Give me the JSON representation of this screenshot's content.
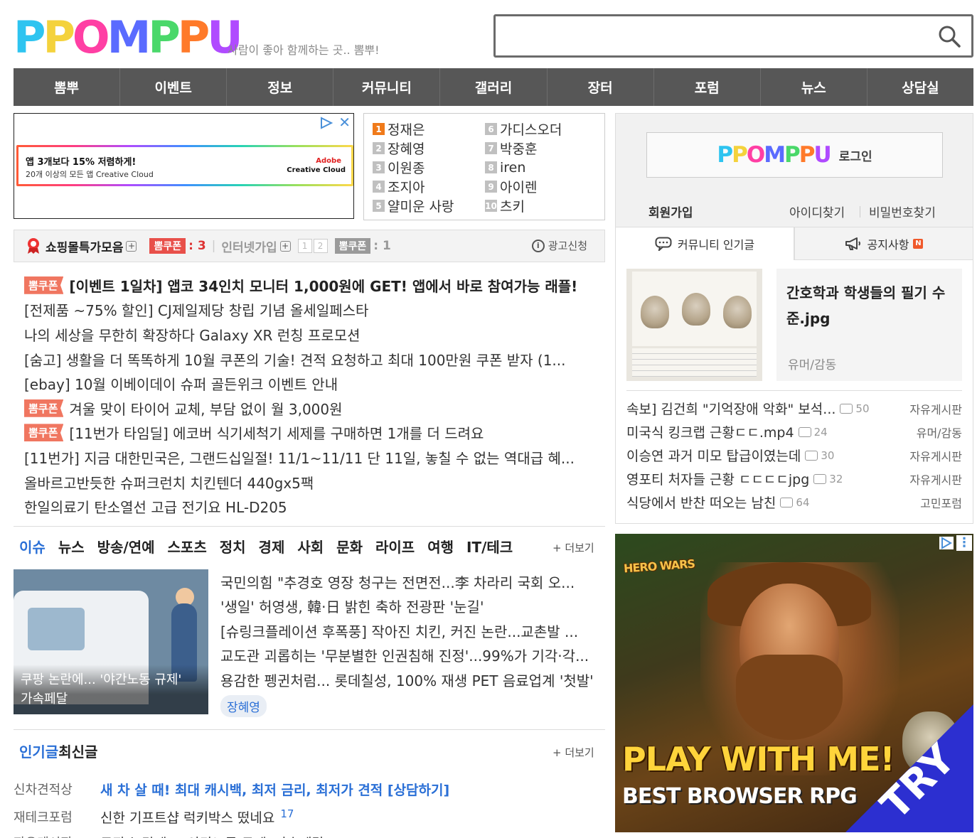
{
  "header": {
    "logo_letters": [
      "P",
      "P",
      "O",
      "M",
      "P",
      "P",
      "U"
    ],
    "logo_colors": [
      "#2ec4f0",
      "#f4d23c",
      "#ff3fa4",
      "#5a6bff",
      "#4ad86a",
      "#ff7a2a",
      "#b04bff"
    ],
    "tagline": "사람이 좋아 함께하는 곳.. 뽐뿌!",
    "search_placeholder": ""
  },
  "nav": [
    "뽐뿌",
    "이벤트",
    "정보",
    "커뮤니티",
    "갤러리",
    "장터",
    "포럼",
    "뉴스",
    "상담실"
  ],
  "ad_small": {
    "title": "앱 3개보다 15% 저렴하게!",
    "subtitle": "20개 이상의 모든 앱 Creative Cloud",
    "brand_top": "Adobe",
    "brand_bottom": "Creative Cloud",
    "close": "✕"
  },
  "ranking": {
    "left": [
      {
        "num": "1",
        "name": "정재은"
      },
      {
        "num": "2",
        "name": "장혜영"
      },
      {
        "num": "3",
        "name": "이원종"
      },
      {
        "num": "4",
        "name": "조지아"
      },
      {
        "num": "5",
        "name": "얄미운 사랑"
      }
    ],
    "right": [
      {
        "num": "6",
        "name": "가디스오더"
      },
      {
        "num": "7",
        "name": "박중훈"
      },
      {
        "num": "8",
        "name": "iren"
      },
      {
        "num": "9",
        "name": "아이렌"
      },
      {
        "num": "10",
        "name": "츠키"
      }
    ]
  },
  "shopbar": {
    "title": "쇼핑몰특가모음",
    "plus": "+",
    "coupon_label": "뽐쿠폰",
    "coupon_count": ": 3",
    "sep": "|",
    "internet": "인터넷가입",
    "pages": [
      "1",
      "2"
    ],
    "coupon_count2": ": 1",
    "ad_request": "광고신청",
    "info": "i"
  },
  "hotlist": [
    {
      "badge": "뽐쿠폰",
      "text": "[이벤트 1일차] 앱코 34인치 모니터 1,000원에 GET! 앱에서 바로 참여가능 래플!",
      "strong": true
    },
    {
      "badge": "",
      "text": "[전제품 ~75% 할인] CJ제일제당 창립 기념 올세일페스타",
      "strong": false
    },
    {
      "badge": "",
      "text": "나의 세상을 무한히 확장하다 Galaxy XR 런칭 프로모션",
      "strong": false
    },
    {
      "badge": "",
      "text": "[숨고] 생활을 더 똑똑하게 10월 쿠폰의 기술! 견적 요청하고 최대 100만원 쿠폰 받자 (1...",
      "strong": false
    },
    {
      "badge": "",
      "text": "[ebay] 10월 이베이데이 슈퍼 골든위크 이벤트 안내",
      "strong": false
    },
    {
      "badge": "뽐쿠폰",
      "text": "겨울 맞이 타이어 교체, 부담 없이 월 3,000원",
      "strong": false
    },
    {
      "badge": "뽐쿠폰",
      "text": "[11번가 타임딜] 에코버 식기세척기 세제를 구매하면 1개를 더 드려요",
      "strong": false
    },
    {
      "badge": "",
      "text": "[11번가] 지금 대한민국은, 그랜드십일절! 11/1~11/11 단 11일, 놓칠 수 없는 역대급 혜...",
      "strong": false
    },
    {
      "badge": "",
      "text": "올바르고반듯한 슈퍼크런치 치킨텐더 440gx5팩",
      "strong": false
    },
    {
      "badge": "",
      "text": "한일의료기 탄소열선 고급 전기요 HL-D205",
      "strong": false
    }
  ],
  "news": {
    "tabs": [
      "이슈",
      "뉴스",
      "방송/연예",
      "스포츠",
      "정치",
      "경제",
      "사회",
      "문화",
      "라이프",
      "여행",
      "IT/테크"
    ],
    "more": "+ 더보기",
    "image_caption_1": "쿠팡 논란에... '야간노동 규제'",
    "image_caption_2": "가속페달",
    "items": [
      "국민의힘 \"추경호 영장 청구는 전면전...李 차라리 국회 오...",
      "'생일' 허영생, 韓·日 밝힌 축하 전광판 '눈길'",
      "[슈링크플레이션 후폭풍] 작아진 치킨, 커진 논란...교촌발 ...",
      "교도관 괴롭히는 '무분별한 인권침해 진정'...99%가 기각·각...",
      "용감한 펭귄처럼... 롯데칠성, 100% 재생 PET 음료업계 '첫발'"
    ],
    "tag": "장혜영"
  },
  "popular": {
    "tabs": [
      "인기글",
      "최신글"
    ],
    "more": "+ 더보기",
    "rows": [
      {
        "cat": "신차견적상",
        "title": "새 차 살 때! 최대 캐시백, 최저 금리, 최저가 견적 [상담하기]",
        "num": "",
        "blue": true
      },
      {
        "cat": "재테크포럼",
        "title": "신한 기프트샵 럭키박스 떴네요",
        "num": "17",
        "blue": false
      },
      {
        "cat": "자유게시판",
        "title": "쿠팡 논란에... '야간노동 규제' 가속페달",
        "num": "",
        "blue": false
      }
    ]
  },
  "login": {
    "logo_letters": [
      "P",
      "P",
      "O",
      "M",
      "P",
      "P",
      "U"
    ],
    "button_label": "로그인",
    "join": "회원가입",
    "find_id": "아이디찾기",
    "find_pw": "비밀번호찾기"
  },
  "right_tabs": {
    "community": "커뮤니티 인기글",
    "notice": "공지사항",
    "new_badge": "N"
  },
  "featured": {
    "title": "간호학과 학생들의 필기 수준.jpg",
    "category": "유머/감동"
  },
  "right_list": [
    {
      "title": "속보] 김건희 \"기억장애 악화\" 보석...",
      "comments": "50",
      "board": "자유게시판"
    },
    {
      "title": "미국식 킹크랩 근황ㄷㄷ.mp4",
      "comments": "24",
      "board": "유머/감동"
    },
    {
      "title": "이승연 과거 미모 탑급이였는데",
      "comments": "30",
      "board": "자유게시판"
    },
    {
      "title": "영포티 처자들 근황 ㄷㄷㄷㄷjpg",
      "comments": "32",
      "board": "자유게시판"
    },
    {
      "title": "식당에서 반찬 떠오는 남친",
      "comments": "64",
      "board": "고민포럼"
    }
  ],
  "ad_big": {
    "brand": "HERO WARS",
    "headline": "PLAY WITH ME!",
    "subline": "BEST BROWSER RPG",
    "cta": "TRY",
    "menu": "⋮"
  }
}
